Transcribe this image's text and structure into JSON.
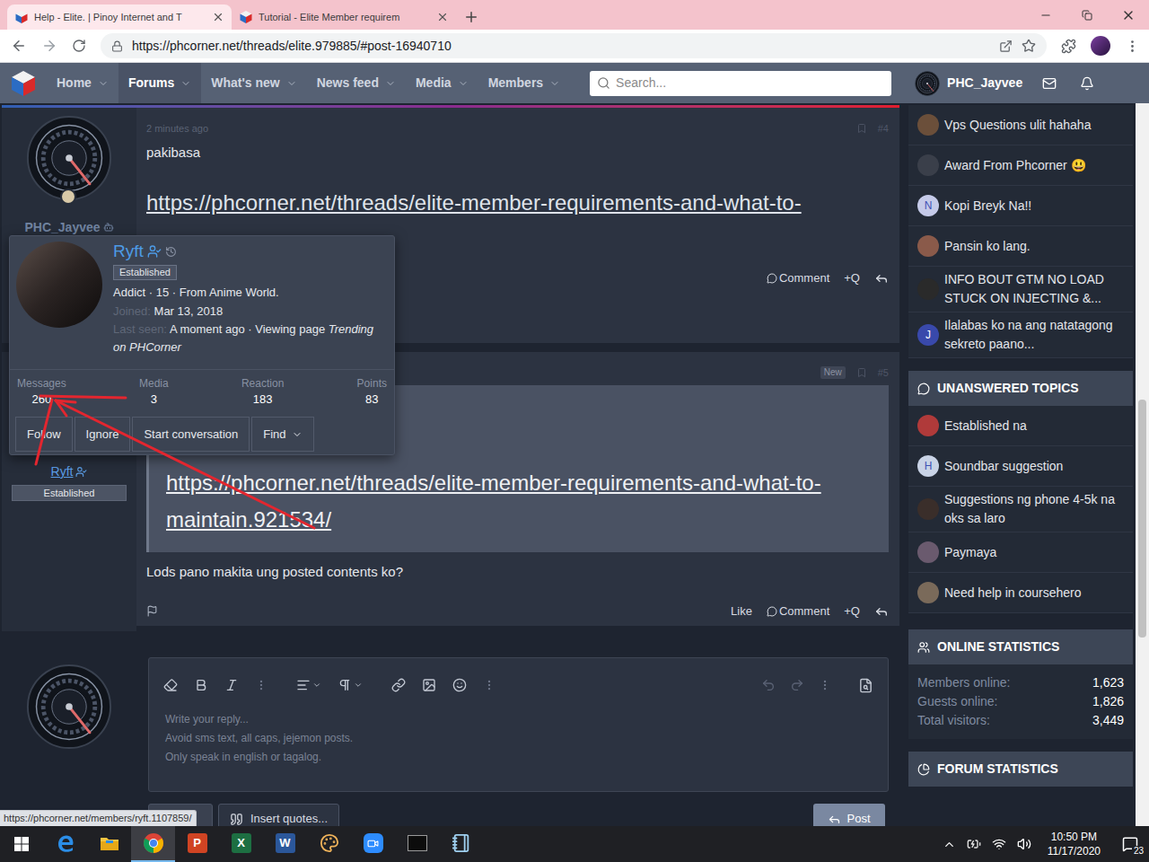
{
  "browser": {
    "tabs": [
      {
        "title": "Help - Elite. | Pinoy Internet and T",
        "selected": true
      },
      {
        "title": "Tutorial - Elite Member requirem",
        "selected": false
      }
    ],
    "address": "https://phcorner.net/threads/elite.979885/#post-16940710",
    "status_url": "https://phcorner.net/members/ryft.1107859/"
  },
  "site_nav": {
    "items": [
      {
        "label": "Home",
        "selected": false
      },
      {
        "label": "Forums",
        "selected": true
      },
      {
        "label": "What's new",
        "selected": false
      },
      {
        "label": "News feed",
        "selected": false
      },
      {
        "label": "Media",
        "selected": false
      },
      {
        "label": "Members",
        "selected": false
      }
    ],
    "search_placeholder": "Search...",
    "user": "PHC_Jayvee"
  },
  "posts": [
    {
      "author": "PHC_Jayvee",
      "avatar_kind": "gauge",
      "time": "2 minutes ago",
      "number": "#4",
      "paragraphs": [
        {
          "kind": "text",
          "text": "pakibasa"
        },
        {
          "kind": "link",
          "text": "https://phcorner.net/threads/elite-member-requirements-and-what-to-"
        }
      ],
      "actions": [
        {
          "label": "Comment",
          "kind": "comment"
        },
        {
          "label": "+Q",
          "kind": "plain"
        }
      ]
    },
    {
      "author": "Ryft",
      "avatar_kind": "photo",
      "badge": "Established",
      "new_label": "New",
      "number": "#5",
      "paragraphs": [
        {
          "kind": "quote",
          "text": "https://phcorner.net/threads/elite-member-requirements-and-what-to-maintain.921534/"
        },
        {
          "kind": "text",
          "text": "Lods pano makita ung posted contents ko?"
        }
      ],
      "actions": [
        {
          "label": "Like",
          "kind": "plain"
        },
        {
          "label": "Comment",
          "kind": "comment"
        },
        {
          "label": "+Q",
          "kind": "plain"
        }
      ]
    }
  ],
  "member_card": {
    "name": "Ryft",
    "badge": "Established",
    "info": "Addict · 15 · From Anime World.",
    "joined_label": "Joined:",
    "joined": "Mar 13, 2018",
    "last_seen_label": "Last seen:",
    "last_seen": "A moment ago · Viewing page ",
    "last_seen_page": "Trending on PHCorner",
    "stats": [
      {
        "label": "Messages",
        "value": "260"
      },
      {
        "label": "Media",
        "value": "3"
      },
      {
        "label": "Reaction",
        "value": "183"
      },
      {
        "label": "Points",
        "value": "83"
      }
    ],
    "buttons": [
      {
        "label": "Follow",
        "dropdown": false
      },
      {
        "label": "Ignore",
        "dropdown": false
      },
      {
        "label": "Start conversation",
        "dropdown": false
      },
      {
        "label": "Find",
        "dropdown": true
      }
    ]
  },
  "reply_editor": {
    "placeholder_lines": [
      "Write your reply...",
      "Avoid sms text, all caps, jejemon posts.",
      "Only speak in english or tagalog."
    ],
    "insert_button": "Insert quotes...",
    "post_button": "Post"
  },
  "sidebar": {
    "latest": [
      {
        "title": "Vps Questions ulit hahaha",
        "color": "#6b4f3a"
      },
      {
        "title": "Award From Phcorner 😃",
        "color": "#3a3f4a"
      },
      {
        "title": "Kopi Breyk Na!!",
        "avatar_letter": "N",
        "color": "#c5cae9"
      },
      {
        "title": "Pansin ko lang.",
        "color": "#8a5a4a"
      },
      {
        "title": "INFO BOUT GTM NO LOAD STUCK ON INJECTING &...",
        "color": "#2a2a2a"
      },
      {
        "title": "Ilalabas ko na ang natatagong sekreto paano...",
        "avatar_letter": "J",
        "color": "#3949ab"
      }
    ],
    "unanswered": {
      "title": "UNANSWERED TOPICS",
      "items": [
        {
          "title": "Established na",
          "color": "#b03a3a"
        },
        {
          "title": "Soundbar suggestion",
          "avatar_letter": "H",
          "color": "#c9d3e6"
        },
        {
          "title": "Suggestions ng phone 4-5k na oks sa laro",
          "color": "#3a2e2a"
        },
        {
          "title": "Paymaya",
          "color": "#6a5a6e"
        },
        {
          "title": "Need help in coursehero",
          "color": "#7a6a5a"
        }
      ]
    },
    "online": {
      "title": "ONLINE STATISTICS",
      "rows": [
        {
          "label": "Members online:",
          "value": "1,623"
        },
        {
          "label": "Guests online:",
          "value": "1,826"
        },
        {
          "label": "Total visitors:",
          "value": "3,449"
        }
      ]
    },
    "forum": {
      "title": "FORUM STATISTICS"
    }
  },
  "taskbar": {
    "apps": [
      {
        "kind": "edge",
        "selected": false
      },
      {
        "kind": "explorer",
        "selected": false
      },
      {
        "kind": "chrome",
        "selected": true
      },
      {
        "kind": "letter",
        "glyph": "P",
        "color": "#d04423",
        "selected": false
      },
      {
        "kind": "letter",
        "glyph": "X",
        "color": "#1d6f42",
        "selected": false
      },
      {
        "kind": "letter",
        "glyph": "W",
        "color": "#2b579a",
        "selected": false
      },
      {
        "kind": "paint",
        "selected": false
      },
      {
        "kind": "zoom",
        "selected": false
      },
      {
        "kind": "terminal",
        "selected": false
      },
      {
        "kind": "notepad",
        "selected": false
      }
    ],
    "time": "10:50 PM",
    "date": "11/17/2020",
    "notifications": "23"
  }
}
